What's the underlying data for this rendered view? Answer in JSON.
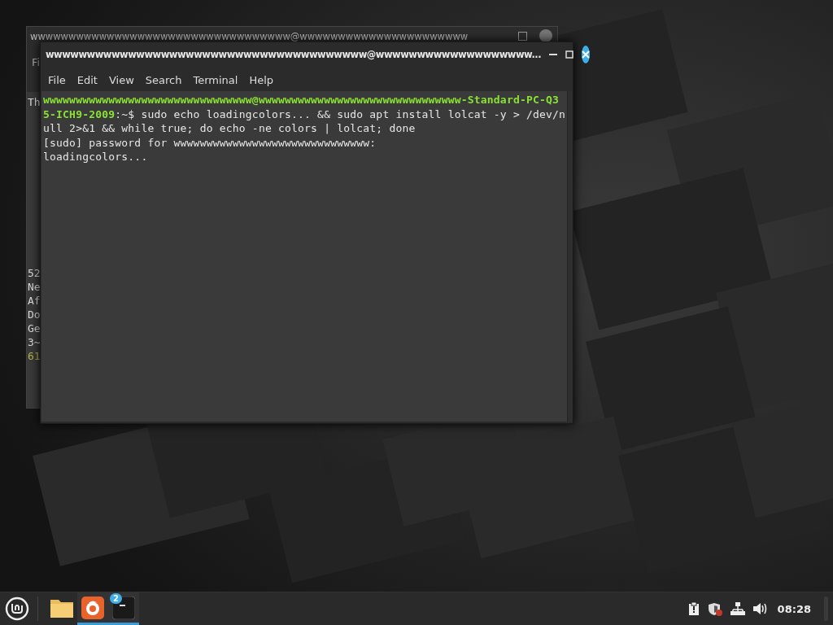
{
  "background_window": {
    "title": "wwwwwwwwwwwwwwwwwwwwwwwwwwwwwwwwww@wwwwwwwwwwwwwwwwwwwwww",
    "menu_fragment": "Fi",
    "lines": [
      {
        "text": "Th",
        "kind": "plain"
      },
      {
        "text": "52",
        "kind": "plain"
      },
      {
        "text": "Ne",
        "kind": "plain"
      },
      {
        "text": "Af",
        "kind": "plain"
      },
      {
        "text": "Do",
        "kind": "plain"
      },
      {
        "text": "Ge",
        "kind": "plain"
      },
      {
        "text": "3~",
        "kind": "plain"
      },
      {
        "text": "61",
        "kind": "accent"
      }
    ]
  },
  "terminal_window": {
    "title": "wwwwwwwwwwwwwwwwwwwwwwwwwwwwwwwwwwwwwww@wwwwwwwwwwwwwwwwwww...",
    "menu": [
      "File",
      "Edit",
      "View",
      "Search",
      "Terminal",
      "Help"
    ],
    "lines": [
      {
        "segments": [
          {
            "text": "wwwwwwwwwwwwwwwwwwwwwwwwwwwwwwww@wwwwwwwwwwwwwwwwwwwwwwwwwwwwwww-Standard-PC-Q3",
            "kind": "prompt"
          }
        ]
      },
      {
        "segments": [
          {
            "text": "5-ICH9-2009",
            "kind": "prompt"
          },
          {
            "text": ":~$ sudo echo loadingcolors... && sudo apt install lolcat -y > /dev/n",
            "kind": "plain"
          }
        ]
      },
      {
        "segments": [
          {
            "text": "ull 2>&1 && while true; do echo -ne colors | lolcat; done",
            "kind": "plain"
          }
        ]
      },
      {
        "segments": [
          {
            "text": "[sudo] password for wwwwwwwwwwwwwwwwwwwwwwwwwwwwww:",
            "kind": "plain"
          }
        ]
      },
      {
        "segments": [
          {
            "text": "loadingcolors...",
            "kind": "plain"
          }
        ]
      }
    ]
  },
  "taskbar": {
    "apps": [
      {
        "kind": "files",
        "running": false
      },
      {
        "kind": "browser",
        "running": true
      },
      {
        "kind": "terminal",
        "running": true,
        "badge": "2"
      }
    ],
    "tray": [
      {
        "kind": "clipboard"
      },
      {
        "kind": "shield"
      },
      {
        "kind": "network"
      },
      {
        "kind": "volume"
      }
    ],
    "clock": "08:28"
  }
}
